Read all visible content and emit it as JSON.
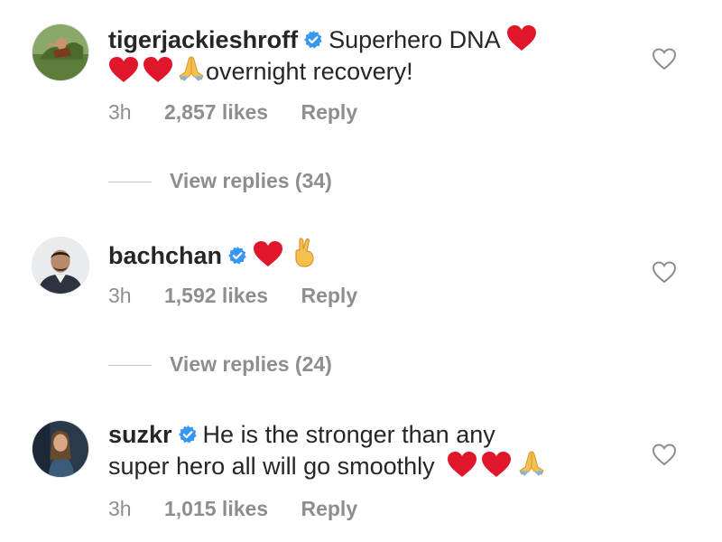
{
  "comments": [
    {
      "username": "tigerjackieshroff",
      "text_line1": "Superhero DNA",
      "text_line2": "overnight recovery!",
      "time": "3h",
      "likes": "2,857 likes",
      "reply_label": "Reply",
      "view_replies": "View replies (34)"
    },
    {
      "username": "bachchan",
      "time": "3h",
      "likes": "1,592 likes",
      "reply_label": "Reply",
      "view_replies": "View replies (24)"
    },
    {
      "username": "suzkr",
      "text_line1": "He is the stronger than any",
      "text_line2": "super hero all will go smoothly",
      "time": "3h",
      "likes": "1,015 likes",
      "reply_label": "Reply"
    }
  ],
  "icons": {
    "verified": "verified-badge-icon",
    "heart_emoji": "red-heart-emoji",
    "pray_emoji": "folded-hands-emoji",
    "fingers_crossed_emoji": "crossed-fingers-emoji",
    "like": "heart-outline-icon"
  },
  "colors": {
    "verified_blue": "#3897f0",
    "heart_red": "#e0162b",
    "meta_gray": "#8e8e8e"
  }
}
